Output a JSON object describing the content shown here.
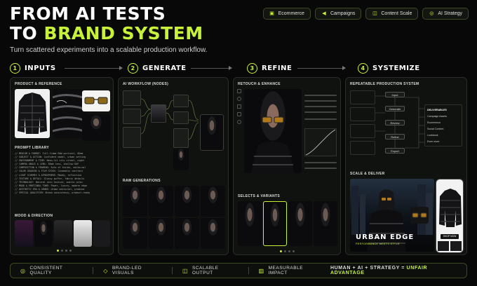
{
  "header": {
    "title_line1": "FROM AI TESTS",
    "title_line2a": "TO",
    "title_line2b": "BRAND SYSTEM",
    "subtitle": "Turn scattered experiments into a scalable production workflow."
  },
  "tags": [
    {
      "label": "Ecommerce",
      "icon": "cart-icon"
    },
    {
      "label": "Campaigns",
      "icon": "megaphone-icon"
    },
    {
      "label": "Content Scale",
      "icon": "layers-icon"
    },
    {
      "label": "AI Strategy",
      "icon": "target-icon"
    }
  ],
  "steps": [
    {
      "num": "1",
      "label": "INPUTS"
    },
    {
      "num": "2",
      "label": "GENERATE"
    },
    {
      "num": "3",
      "label": "REFINE"
    },
    {
      "num": "4",
      "label": "SYSTEMIZE"
    }
  ],
  "inputs": {
    "product_title": "PRODUCT & REFERENCE",
    "prompt_title": "PROMPT LIBRARY",
    "prompt_lines": [
      "// MEDIUM & FORMAT: Full-frame RAW portrait, 85mm",
      "// SUBJECT & ACTION: Confident model, urban setting",
      "// ENVIRONMENT & TIME: Neon-lit city street, night",
      "// CAMERA ANGLE & LENS: 85mm lens, shallow DOF",
      "// COMPOSITION & FRAMING: Rule of thirds, editorial",
      "// COLOR GRADING & FILM STOCK: Cinematic contrast",
      "// LIGHT SCHEMES & ATMOSPHERE: Moody, reflective",
      "// TEXTURE & DETAIL: Glossy puffer, fabric details",
      "// TECHNOLOGY: Natural skin texture, subtle color",
      "// MOOD & EMOTIONAL TONE: Power, luxury, modern edge",
      "// AESTHETIC ERA & GENRE: Urban editorial, premium",
      "// SPECIAL QUALIFIER: Brand consistency, product-ready"
    ],
    "mood_title": "MOOD & DIRECTION"
  },
  "generate": {
    "workflow_title": "AI WORKFLOW (NODES)",
    "raw_title": "RAW GENERATIONS"
  },
  "refine": {
    "retouch_title": "RETOUCH & ENHANCE",
    "selects_title": "SELECTS & VARIANTS"
  },
  "systemize": {
    "pipeline_title": "REPEATABLE PRODUCTION SYSTEM",
    "pipeline_nodes": [
      "Input",
      "Generate",
      "Review",
      "Refine",
      "Export"
    ],
    "deliverables": [
      "DELIVERABLES",
      "Campaign Assets",
      "Ecommerce",
      "Social Content",
      "Lookbook",
      "Even more"
    ],
    "scale_title": "SCALE & DELIVER",
    "banner_title": "URBAN EDGE",
    "banner_sub": "PERFORMANCE MEETS STYLE",
    "phone_button": "SHOP NOW"
  },
  "footer": {
    "items": [
      {
        "label": "CONSISTENT QUALITY",
        "icon": "target-icon"
      },
      {
        "label": "BRAND-LED VISUALS",
        "icon": "diamond-icon"
      },
      {
        "label": "SCALABLE OUTPUT",
        "icon": "layers-icon"
      },
      {
        "label": "MEASURABLE IMPACT",
        "icon": "chart-icon"
      }
    ],
    "tagline_a": "HUMAN + AI + STRATEGY =",
    "tagline_b": "UNFAIR ADVANTAGE"
  },
  "colors": {
    "accent": "#c8f23a",
    "background": "#070807",
    "panel": "#101210"
  }
}
